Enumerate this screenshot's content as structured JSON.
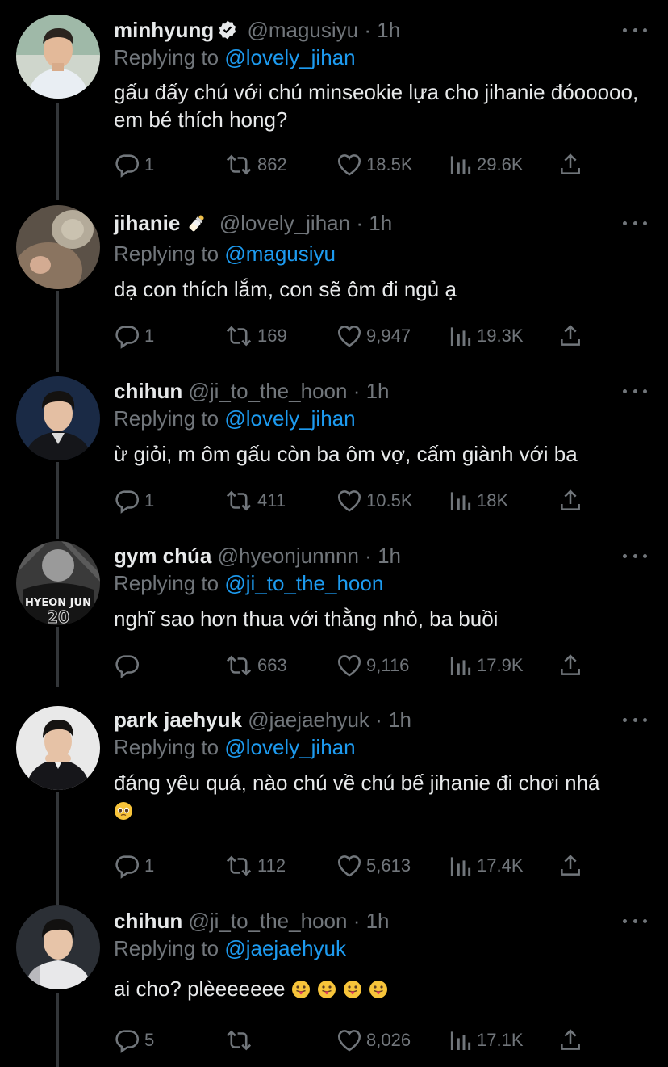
{
  "replying_to_label": "Replying to",
  "tweets": [
    {
      "name": "minhyung",
      "verified": true,
      "handle": "@magusiyu",
      "time": "1h",
      "replying_to": "@lovely_jihan",
      "text": "gấu đấy chú với chú minseokie lựa cho jihanie đóooooo, em bé thích hong?",
      "replies": "1",
      "retweets": "862",
      "likes": "18.5K",
      "views": "29.6K"
    },
    {
      "name": "jihanie",
      "name_emoji": "baby-bottle",
      "handle": "@lovely_jihan",
      "time": "1h",
      "replying_to": "@magusiyu",
      "text": "dạ con thích lắm, con sẽ ôm đi ngủ ạ",
      "replies": "1",
      "retweets": "169",
      "likes": "9,947",
      "views": "19.3K"
    },
    {
      "name": "chihun",
      "handle": "@ji_to_the_hoon",
      "time": "1h",
      "replying_to": "@lovely_jihan",
      "text": "ừ giỏi, m ôm gấu còn ba ôm vợ, cấm giành với ba",
      "replies": "1",
      "retweets": "411",
      "likes": "10.5K",
      "views": "18K"
    },
    {
      "name": "gym chúa",
      "handle": "@hyeonjunnnn",
      "time": "1h",
      "replying_to": "@ji_to_the_hoon",
      "text": "nghĩ sao hơn thua với thằng nhỏ, ba buồi",
      "avatar_text": "HYEON JUN",
      "replies": "",
      "retweets": "663",
      "likes": "9,116",
      "views": "17.9K"
    },
    {
      "name": "park jaehyuk",
      "handle": "@jaejaehyuk",
      "time": "1h",
      "replying_to": "@lovely_jihan",
      "text": "đáng yêu quá, nào chú về chú bế jihanie đi chơi nhá",
      "text_emoji": "pleading-face",
      "replies": "1",
      "retweets": "112",
      "likes": "5,613",
      "views": "17.4K"
    },
    {
      "name": "chihun",
      "handle": "@ji_to_the_hoon",
      "time": "1h",
      "replying_to": "@jaejaehyuk",
      "text": "ai cho? plèeeeeee",
      "text_emoji": "tongue-face x4",
      "replies": "5",
      "retweets": "",
      "likes": "8,026",
      "views": "17.1K"
    }
  ],
  "colors": {
    "background": "#000000",
    "text": "#e7e9ea",
    "muted": "#71767b",
    "accent": "#1d9bf0",
    "thread_line": "#333639"
  }
}
